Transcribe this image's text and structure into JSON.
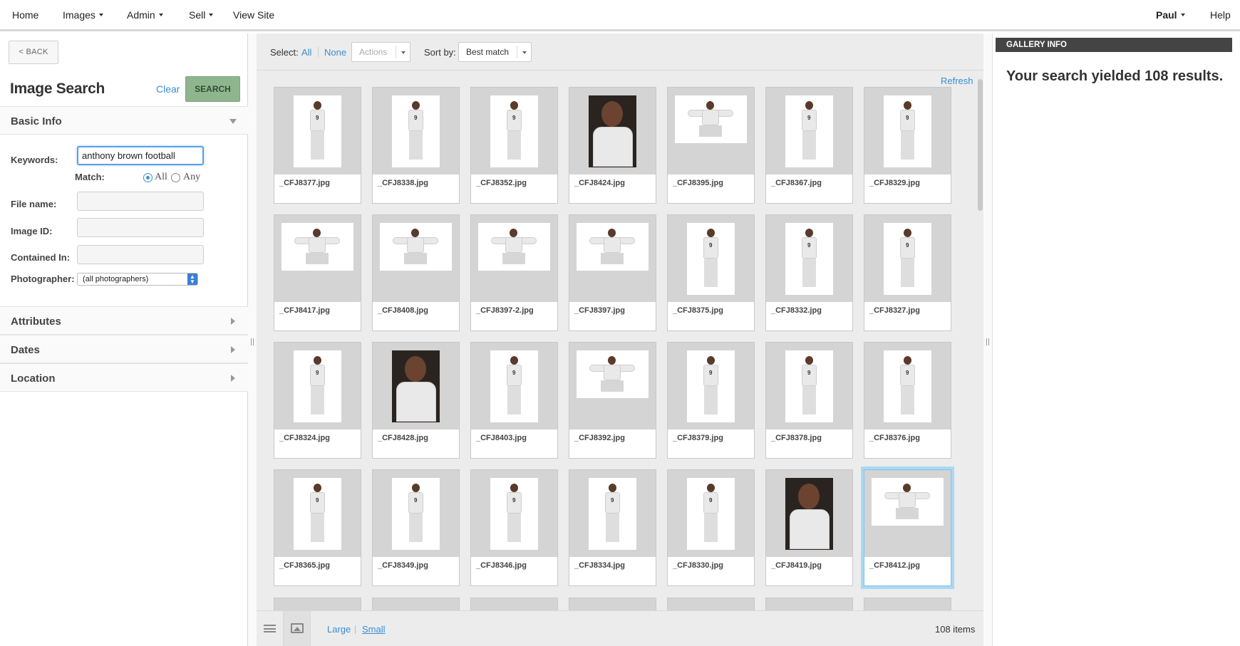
{
  "nav": {
    "home": "Home",
    "images": "Images",
    "admin": "Admin",
    "sell": "Sell",
    "view_site": "View Site",
    "user": "Paul",
    "help": "Help"
  },
  "search_panel": {
    "back_label": "< BACK",
    "title": "Image Search",
    "clear_label": "Clear",
    "search_label": "SEARCH",
    "basic_info_label": "Basic Info",
    "keywords_label": "Keywords:",
    "keywords_value": "anthony brown football",
    "match_label": "Match:",
    "match_all": "All",
    "match_any": "Any",
    "match_selected": "All",
    "file_name_label": "File name:",
    "image_id_label": "Image ID:",
    "contained_in_label": "Contained In:",
    "photographer_label": "Photographer:",
    "photographer_value": "(all photographers)",
    "sections": [
      "Attributes",
      "Dates",
      "Location"
    ]
  },
  "toolbar": {
    "select_label": "Select:",
    "select_all": "All",
    "select_none": "None",
    "actions_label": "Actions",
    "sort_label": "Sort by:",
    "sort_value": "Best match",
    "refresh_label": "Refresh"
  },
  "grid": {
    "selected_file": "_CFJ8412.jpg",
    "rows": [
      [
        "_CFJ8377.jpg",
        "_CFJ8338.jpg",
        "_CFJ8352.jpg",
        "_CFJ8424.jpg",
        "_CFJ8395.jpg",
        "_CFJ8367.jpg",
        "_CFJ8329.jpg"
      ],
      [
        "_CFJ8417.jpg",
        "_CFJ8408.jpg",
        "_CFJ8397-2.jpg",
        "_CFJ8397.jpg",
        "_CFJ8375.jpg",
        "_CFJ8332.jpg",
        "_CFJ8327.jpg"
      ],
      [
        "_CFJ8324.jpg",
        "_CFJ8428.jpg",
        "_CFJ8403.jpg",
        "_CFJ8392.jpg",
        "_CFJ8379.jpg",
        "_CFJ8378.jpg",
        "_CFJ8376.jpg"
      ],
      [
        "_CFJ8365.jpg",
        "_CFJ8349.jpg",
        "_CFJ8346.jpg",
        "_CFJ8334.jpg",
        "_CFJ8330.jpg",
        "_CFJ8419.jpg",
        "_CFJ8412.jpg"
      ]
    ],
    "jersey_number": "9"
  },
  "statusbar": {
    "large_label": "Large",
    "small_label": "Small",
    "item_count": "108 items"
  },
  "gallery_info": {
    "header": "GALLERY INFO",
    "result_text": "Your search yielded 108 results."
  }
}
